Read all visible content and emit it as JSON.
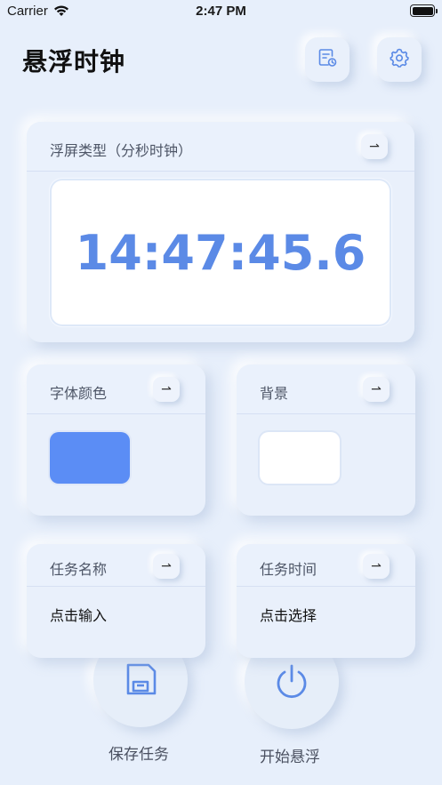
{
  "status_bar": {
    "carrier": "Carrier",
    "time": "2:47 PM"
  },
  "header": {
    "title": "悬浮时钟",
    "icons": [
      "history-icon",
      "gear-icon"
    ]
  },
  "clock_card": {
    "label": "浮屏类型（分秒时钟）",
    "toggle_glyph": "⇀",
    "clock_value": "14:47:45.6",
    "clock_color": "#5b8ae6"
  },
  "font_color_card": {
    "label": "字体颜色",
    "toggle_glyph": "⇀",
    "swatch_color": "#5b8df5"
  },
  "background_card": {
    "label": "背景",
    "toggle_glyph": "⇀",
    "swatch_color": "#ffffff"
  },
  "task_name_card": {
    "label": "任务名称",
    "toggle_glyph": "⇀",
    "value": "点击输入"
  },
  "task_time_card": {
    "label": "任务时间",
    "toggle_glyph": "⇀",
    "value": "点击选择"
  },
  "actions": {
    "save_label": "保存任务",
    "start_label": "开始悬浮",
    "accent_color": "#5b8ae6"
  }
}
